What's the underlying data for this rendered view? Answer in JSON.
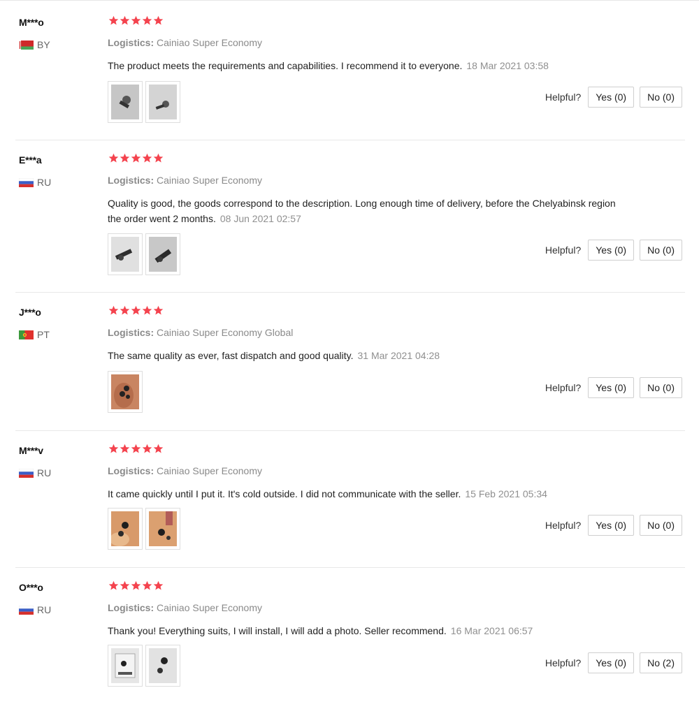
{
  "labels": {
    "logistics_key": "Logistics:",
    "helpful": "Helpful?"
  },
  "colors": {
    "star": "#f4434e",
    "divider": "#e8e8e8",
    "muted_text": "#8a8a8a"
  },
  "reviews": [
    {
      "user": "M***o",
      "country": "BY",
      "flag": "belarus",
      "rating": 5,
      "logistics": "Cainiao Super Economy",
      "text": "The product meets the requirements and capabilities. I recommend it to everyone.",
      "date": "18 Mar 2021 03:58",
      "photos": [
        "product-photo-1",
        "product-photo-2"
      ],
      "yes": "Yes (0)",
      "no": "No (0)"
    },
    {
      "user": "E***a",
      "country": "RU",
      "flag": "russia",
      "rating": 5,
      "logistics": "Cainiao Super Economy",
      "text": "Quality is good, the goods correspond to the description. Long enough time of delivery, before the Chelyabinsk region the order went 2 months.",
      "date": "08 Jun 2021 02:57",
      "photos": [
        "product-photo-1",
        "product-photo-2"
      ],
      "yes": "Yes (0)",
      "no": "No (0)"
    },
    {
      "user": "J***o",
      "country": "PT",
      "flag": "portugal",
      "rating": 5,
      "logistics": "Cainiao Super Economy Global",
      "text": "The same quality as ever, fast dispatch and good quality.",
      "date": "31 Mar 2021 04:28",
      "photos": [
        "product-in-hand-photo"
      ],
      "yes": "Yes (0)",
      "no": "No (0)"
    },
    {
      "user": "M***v",
      "country": "RU",
      "flag": "russia",
      "rating": 5,
      "logistics": "Cainiao Super Economy",
      "text": "It came quickly until I put it. It's cold outside. I did not communicate with the seller.",
      "date": "15 Feb 2021 05:34",
      "photos": [
        "installed-product-photo-1",
        "installed-product-photo-2"
      ],
      "yes": "Yes (0)",
      "no": "No (0)"
    },
    {
      "user": "O***o",
      "country": "RU",
      "flag": "russia",
      "rating": 5,
      "logistics": "Cainiao Super Economy",
      "text": "Thank you! Everything suits, I will install, I will add a photo. Seller recommend.",
      "date": "16 Mar 2021 06:57",
      "photos": [
        "product-package-photo-1",
        "product-package-photo-2"
      ],
      "yes": "Yes (0)",
      "no": "No (2)"
    }
  ]
}
